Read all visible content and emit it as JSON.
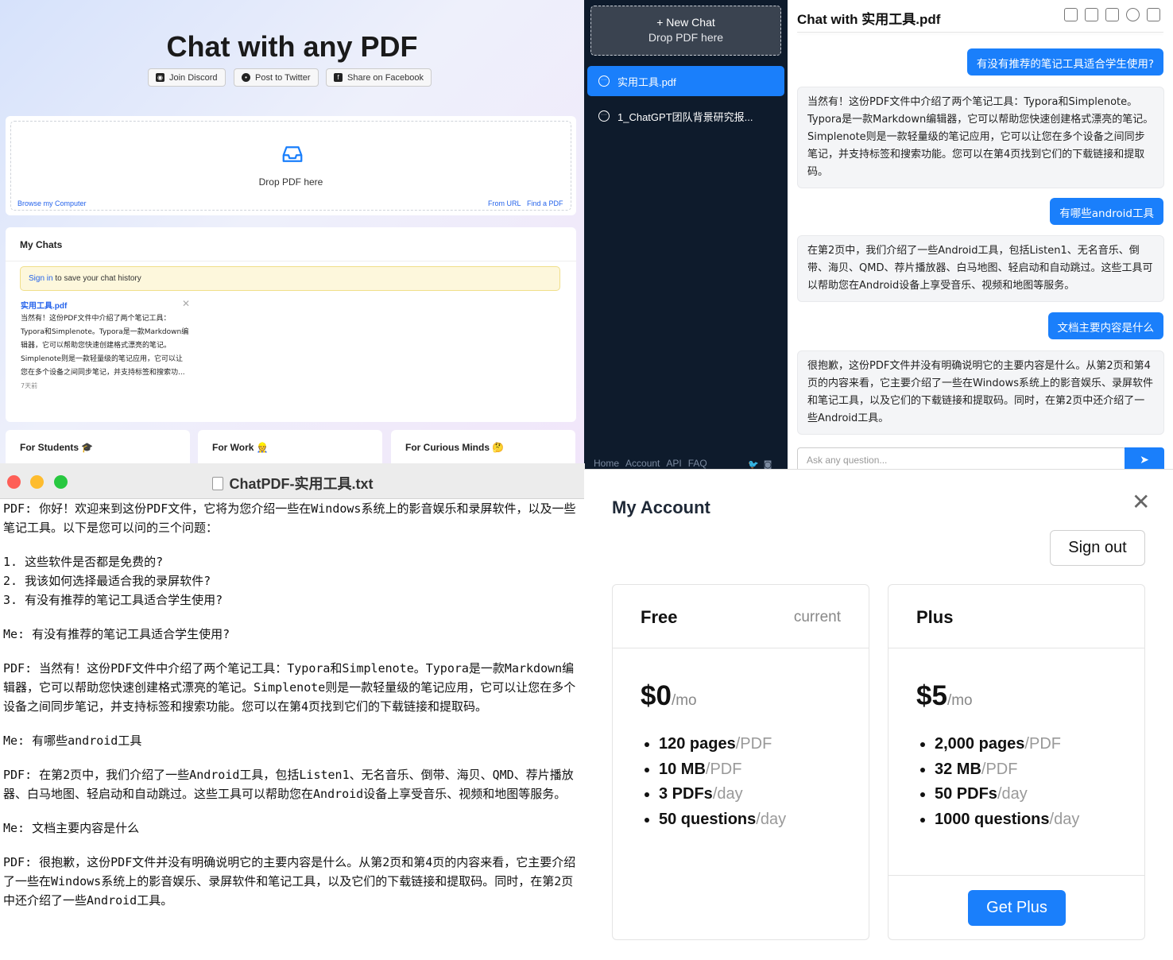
{
  "landing": {
    "title": "Chat with any PDF",
    "social": {
      "discord": "Join Discord",
      "twitter": "Post to Twitter",
      "facebook": "Share on Facebook"
    },
    "drop_text": "Drop PDF here",
    "browse": "Browse my Computer",
    "from_url": "From URL",
    "find_pdf": "Find a PDF",
    "my_chats_title": "My Chats",
    "signin_link": "Sign in",
    "signin_rest": " to save your chat history",
    "chat_item": {
      "title": "实用工具.pdf",
      "preview": "当然有！这份PDF文件中介绍了两个笔记工具：Typora和Simplenote。Typora是一款Markdown编辑器，它可以帮助您快速创建格式漂亮的笔记。Simplenote则是一款轻量级的笔记应用，它可以让您在多个设备之间同步笔记，并支持标签和搜索功...",
      "date": "7天前"
    },
    "categories": [
      "For Students 🎓",
      "For Work 👷",
      "For Curious Minds 🤔"
    ]
  },
  "sidebar": {
    "new_chat": "+ New Chat",
    "new_chat_sub": "Drop PDF here",
    "items": [
      {
        "label": "实用工具.pdf",
        "active": true
      },
      {
        "label": "1_ChatGPT团队背景研究报...",
        "active": false
      }
    ],
    "footer": [
      "Home",
      "Account",
      "API",
      "FAQ"
    ],
    "footer_icons": [
      "twitter-icon",
      "discord-icon"
    ]
  },
  "chat": {
    "title": "Chat with 实用工具.pdf",
    "tools": [
      "share-icon",
      "edit-icon",
      "download-icon",
      "refresh-icon",
      "trash-icon"
    ],
    "messages": [
      {
        "role": "user",
        "text": "有没有推荐的笔记工具适合学生使用?"
      },
      {
        "role": "pdf",
        "text": "当然有！这份PDF文件中介绍了两个笔记工具：Typora和Simplenote。Typora是一款Markdown编辑器，它可以帮助您快速创建格式漂亮的笔记。Simplenote则是一款轻量级的笔记应用，它可以让您在多个设备之间同步笔记，并支持标签和搜索功能。您可以在第4页找到它们的下载链接和提取码。"
      },
      {
        "role": "user",
        "text": "有哪些android工具"
      },
      {
        "role": "pdf",
        "text": "在第2页中，我们介绍了一些Android工具，包括Listen1、无名音乐、倒带、海贝、QMD、荐片播放器、白马地图、轻启动和自动跳过。这些工具可以帮助您在Android设备上享受音乐、视频和地图等服务。"
      },
      {
        "role": "user",
        "text": "文档主要内容是什么"
      },
      {
        "role": "pdf",
        "text": "很抱歉，这份PDF文件并没有明确说明它的主要内容是什么。从第2页和第4页的内容来看，它主要介绍了一些在Windows系统上的影音娱乐、录屏软件和笔记工具，以及它们的下载链接和提取码。同时，在第2页中还介绍了一些Android工具。"
      }
    ],
    "input_placeholder": "Ask any question..."
  },
  "editor": {
    "title": "ChatPDF-实用工具.txt",
    "paragraphs": [
      "PDF: 你好！欢迎来到这份PDF文件，它将为您介绍一些在Windows系统上的影音娱乐和录屏软件，以及一些笔记工具。以下是您可以问的三个问题：",
      "1. 这些软件是否都是免费的?\n2. 我该如何选择最适合我的录屏软件?\n3. 有没有推荐的笔记工具适合学生使用?",
      "Me: 有没有推荐的笔记工具适合学生使用?",
      "PDF: 当然有！这份PDF文件中介绍了两个笔记工具：Typora和Simplenote。Typora是一款Markdown编辑器，它可以帮助您快速创建格式漂亮的笔记。Simplenote则是一款轻量级的笔记应用，它可以让您在多个设备之间同步笔记，并支持标签和搜索功能。您可以在第4页找到它们的下载链接和提取码。",
      "Me: 有哪些android工具",
      "PDF: 在第2页中，我们介绍了一些Android工具，包括Listen1、无名音乐、倒带、海贝、QMD、荐片播放器、白马地图、轻启动和自动跳过。这些工具可以帮助您在Android设备上享受音乐、视频和地图等服务。",
      "Me: 文档主要内容是什么",
      "PDF: 很抱歉，这份PDF文件并没有明确说明它的主要内容是什么。从第2页和第4页的内容来看，它主要介绍了一些在Windows系统上的影音娱乐、录屏软件和笔记工具，以及它们的下载链接和提取码。同时，在第2页中还介绍了一些Android工具。"
    ]
  },
  "account": {
    "title": "My Account",
    "sign_out": "Sign out",
    "plans": [
      {
        "name": "Free",
        "tag": "current",
        "price": "$0",
        "per": "/mo",
        "features": [
          {
            "v": "120 pages",
            "u": "/PDF"
          },
          {
            "v": "10 MB",
            "u": "/PDF"
          },
          {
            "v": "3 PDFs",
            "u": "/day"
          },
          {
            "v": "50 questions",
            "u": "/day"
          }
        ]
      },
      {
        "name": "Plus",
        "tag": "",
        "price": "$5",
        "per": "/mo",
        "features": [
          {
            "v": "2,000 pages",
            "u": "/PDF"
          },
          {
            "v": "32 MB",
            "u": "/PDF"
          },
          {
            "v": "50 PDFs",
            "u": "/day"
          },
          {
            "v": "1000 questions",
            "u": "/day"
          }
        ],
        "cta": "Get Plus"
      }
    ]
  },
  "colors": {
    "accent": "#1a7ffb",
    "sidebar_bg": "#0e1b2c",
    "link": "#2563eb"
  }
}
